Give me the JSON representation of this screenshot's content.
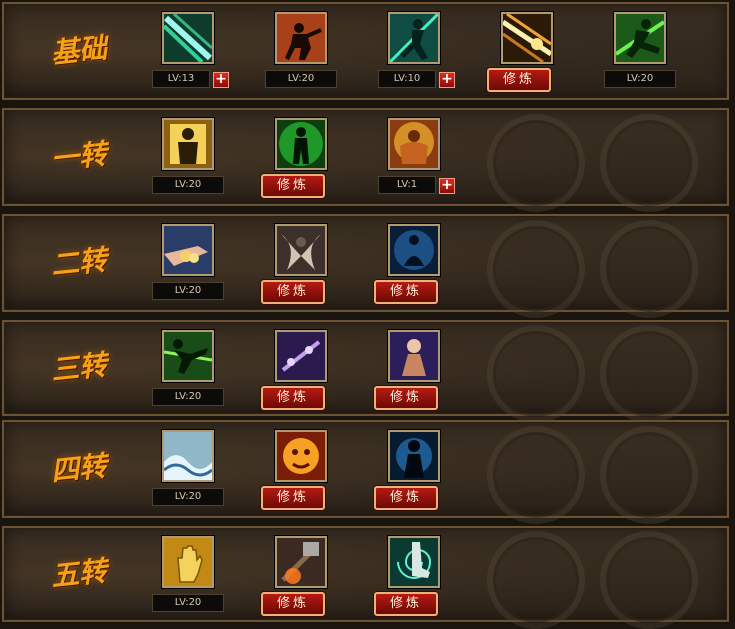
{
  "rows": [
    {
      "label": "基础",
      "skills": [
        {
          "icon": "blade-streak-icon",
          "level": "LV:13",
          "action": "+"
        },
        {
          "icon": "martial-stance-icon",
          "level": "LV:20"
        },
        {
          "icon": "green-runner-icon",
          "level": "LV:10",
          "action": "+"
        },
        {
          "icon": "golden-slash-icon",
          "train": "修炼"
        },
        {
          "icon": "leaping-kick-icon",
          "level": "LV:20"
        }
      ]
    },
    {
      "label": "一转",
      "skills": [
        {
          "icon": "golden-silhouette-icon",
          "level": "LV:20"
        },
        {
          "icon": "green-aura-icon",
          "train": "修炼"
        },
        {
          "icon": "muscled-warrior-icon",
          "level": "LV:1",
          "action": "+"
        }
      ]
    },
    {
      "label": "二转",
      "skills": [
        {
          "icon": "hand-offering-icon",
          "level": "LV:20"
        },
        {
          "icon": "winged-warrior-icon",
          "train": "修炼"
        },
        {
          "icon": "meditation-icon",
          "train": "修炼"
        }
      ]
    },
    {
      "label": "三转",
      "skills": [
        {
          "icon": "flying-kick-icon",
          "level": "LV:20"
        },
        {
          "icon": "purple-staff-icon",
          "train": "修炼"
        },
        {
          "icon": "robed-monk-icon",
          "train": "修炼"
        }
      ]
    },
    {
      "label": "四转",
      "skills": [
        {
          "icon": "wave-icon",
          "level": "LV:20"
        },
        {
          "icon": "flame-face-icon",
          "train": "修炼"
        },
        {
          "icon": "blue-figure-icon",
          "train": "修炼"
        }
      ]
    },
    {
      "label": "五转",
      "skills": [
        {
          "icon": "palm-icon",
          "level": "LV:20"
        },
        {
          "icon": "hammer-strike-icon",
          "train": "修炼"
        },
        {
          "icon": "spiral-foot-icon",
          "train": "修炼"
        }
      ]
    }
  ]
}
